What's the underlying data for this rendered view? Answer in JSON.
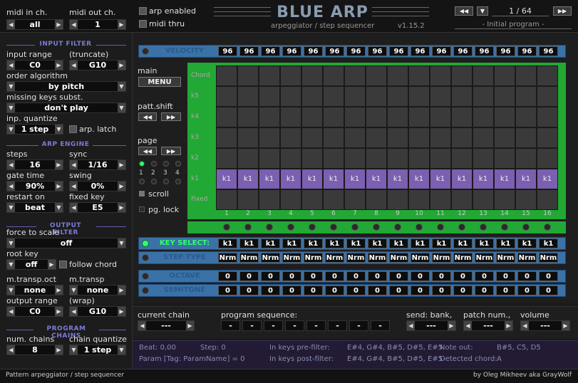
{
  "header": {
    "midi_in_label": "midi in ch.",
    "midi_in_value": "all",
    "midi_out_label": "midi out ch.",
    "midi_out_value": "1",
    "arp_enabled": "arp enabled",
    "midi_thru": "midi thru",
    "title": "BLUE ARP",
    "subtitle": "arpeggiator / step sequencer",
    "version": "v1.15.2",
    "program_counter": "1 / 64",
    "program_name": "- Initial program -"
  },
  "input_filter": {
    "title": "INPUT FILTER",
    "input_range_label": "input range",
    "truncate_label": "(truncate)",
    "range_low": "C0",
    "range_high": "G10",
    "order_label": "order algorithm",
    "order_value": "by pitch",
    "missing_label": "missing keys subst.",
    "missing_value": "don't play",
    "quantize_label": "inp. quantize",
    "quantize_value": "1 step",
    "arp_latch": "arp. latch"
  },
  "arp_engine": {
    "title": "ARP ENGINE",
    "steps_label": "steps",
    "steps_value": "16",
    "sync_label": "sync",
    "sync_value": "1/16",
    "gate_label": "gate time",
    "gate_value": "90%",
    "swing_label": "swing",
    "swing_value": "0%",
    "restart_label": "restart on",
    "restart_value": "beat",
    "fixed_label": "fixed key",
    "fixed_value": "E5"
  },
  "output_filter": {
    "title": "OUTPUT FILTER",
    "force_label": "force to scale",
    "force_value": "off",
    "root_label": "root key",
    "root_value": "off",
    "follow_chord": "follow chord",
    "mtransp_oct_label": "m.transp.oct",
    "mtransp_oct_value": "none",
    "mtransp_label": "m.transp",
    "mtransp_value": "none",
    "output_range_label": "output range",
    "wrap_label": "(wrap)",
    "out_low": "C0",
    "out_high": "G10"
  },
  "program_chains": {
    "title": "PROGRAM CHAINS",
    "num_label": "num. chains",
    "num_value": "8",
    "quantize_label": "chain quantize",
    "quantize_value": "1 step"
  },
  "seq": {
    "velocity_label": "VELOCITY",
    "velocity": [
      "96",
      "96",
      "96",
      "96",
      "96",
      "96",
      "96",
      "96",
      "96",
      "96",
      "96",
      "96",
      "96",
      "96",
      "96",
      "96"
    ],
    "main_label": "main",
    "menu": "MENU",
    "patt_shift": "patt.shift",
    "page_label": "page",
    "page_nums": [
      "1",
      "2",
      "3",
      "4"
    ],
    "scroll": "scroll",
    "pg_lock": "pg. lock",
    "row_labels": [
      "Chord",
      "k5",
      "k4",
      "k3",
      "k2",
      "k1",
      "Fixed"
    ],
    "k1_cells": [
      "k1",
      "k1",
      "k1",
      "k1",
      "k1",
      "k1",
      "k1",
      "k1",
      "k1",
      "k1",
      "k1",
      "k1",
      "k1",
      "k1",
      "k1",
      "k1"
    ],
    "step_nums": [
      "1",
      "2",
      "3",
      "4",
      "5",
      "6",
      "7",
      "8",
      "9",
      "10",
      "11",
      "12",
      "13",
      "14",
      "15",
      "16"
    ],
    "key_select_label": "KEY SELECT:",
    "key_select": [
      "k1",
      "k1",
      "k1",
      "k1",
      "k1",
      "k1",
      "k1",
      "k1",
      "k1",
      "k1",
      "k1",
      "k1",
      "k1",
      "k1",
      "k1",
      "k1"
    ],
    "step_type_label": "STEP TYPE",
    "step_type": [
      "Nrm",
      "Nrm",
      "Nrm",
      "Nrm",
      "Nrm",
      "Nrm",
      "Nrm",
      "Nrm",
      "Nrm",
      "Nrm",
      "Nrm",
      "Nrm",
      "Nrm",
      "Nrm",
      "Nrm",
      "Nrm"
    ],
    "octave_label": "OCTAVE",
    "octave": [
      "0",
      "0",
      "0",
      "0",
      "0",
      "0",
      "0",
      "0",
      "0",
      "0",
      "0",
      "0",
      "0",
      "0",
      "0",
      "0"
    ],
    "semitone_label": "SEMITONE",
    "semitone": [
      "0",
      "0",
      "0",
      "0",
      "0",
      "0",
      "0",
      "0",
      "0",
      "0",
      "0",
      "0",
      "0",
      "0",
      "0",
      "0"
    ]
  },
  "chain": {
    "current_label": "current chain",
    "current_value": "---",
    "progseq_label": "program sequence:",
    "progseq": [
      "-",
      "-",
      "-",
      "-",
      "-",
      "-",
      "-",
      "-"
    ],
    "send_bank_label": "send: bank,",
    "send_bank_value": "---",
    "patch_label": "patch num.,",
    "patch_value": "---",
    "volume_label": "volume",
    "volume_value": "---"
  },
  "status": {
    "beat": "Beat: 0,00",
    "step": "Step: 0",
    "pre_label": "In keys pre-filter:",
    "pre_value": "E#4, G#4, B#5, D#5, E#5",
    "note_label": "Note out:",
    "note_value": "B#5, C5, D5",
    "param": "Param [Tag: ParamName] = 0",
    "post_label": "In keys post-filter:",
    "post_value": "E#4, G#4, B#5, D#5, E#5",
    "chord_label": "Detected chord:",
    "chord_value": "A"
  },
  "footer": {
    "left": "Pattern arpeggiator / step sequencer",
    "right": "by Oleg Mikheev aka GrayWolf"
  }
}
